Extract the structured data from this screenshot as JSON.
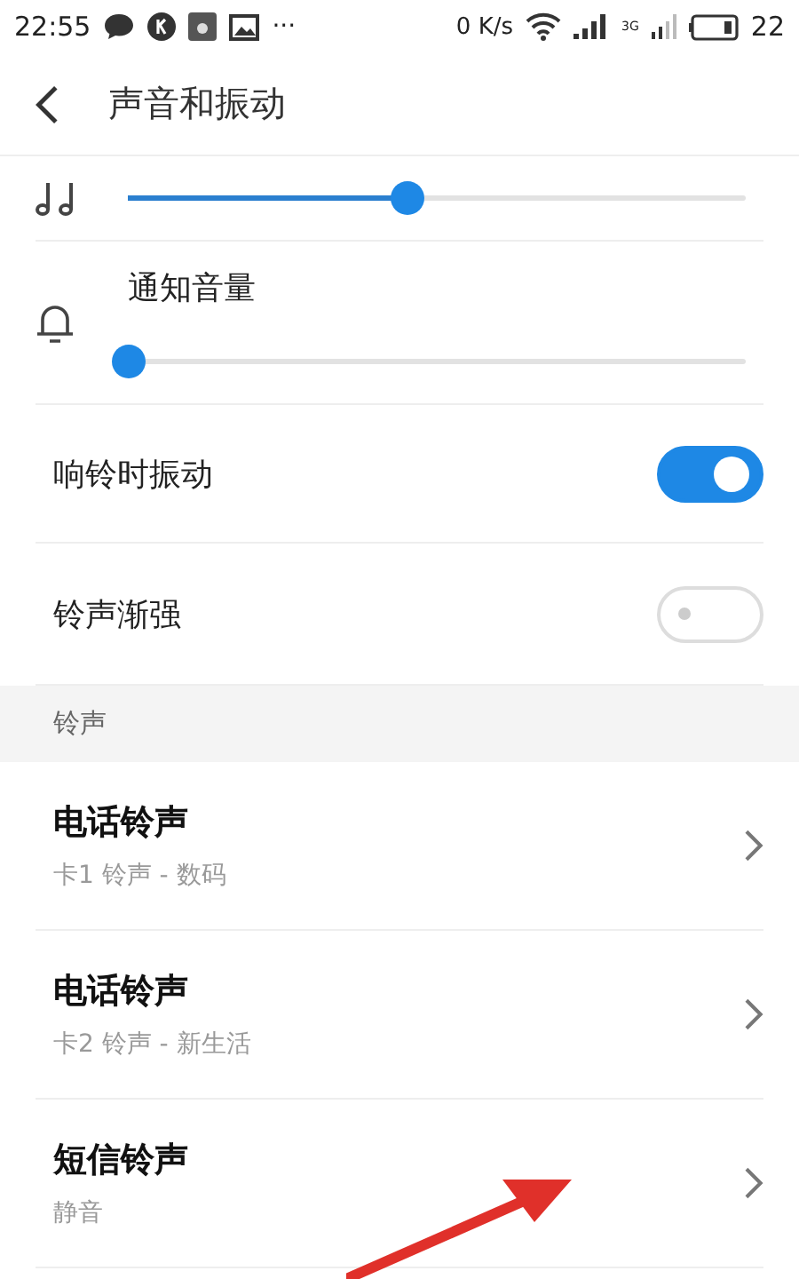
{
  "status_bar": {
    "time": "22:55",
    "more": "···",
    "speed": "0 K/s",
    "network": "3G",
    "battery": "22"
  },
  "header": {
    "title": "声音和振动"
  },
  "volume_sliders": [
    {
      "kind": "music",
      "level": 0.45
    },
    {
      "kind": "bell",
      "label": "通知音量",
      "level": 0
    }
  ],
  "toggles": [
    {
      "label": "响铃时振动",
      "on": true
    },
    {
      "label": "铃声渐强",
      "on": false
    }
  ],
  "section": {
    "title": "铃声"
  },
  "ringtones": [
    {
      "title": "电话铃声",
      "subtitle": "卡1 铃声 - 数码"
    },
    {
      "title": "电话铃声",
      "subtitle": "卡2 铃声 - 新生活"
    },
    {
      "title": "短信铃声",
      "subtitle": "静音"
    }
  ]
}
